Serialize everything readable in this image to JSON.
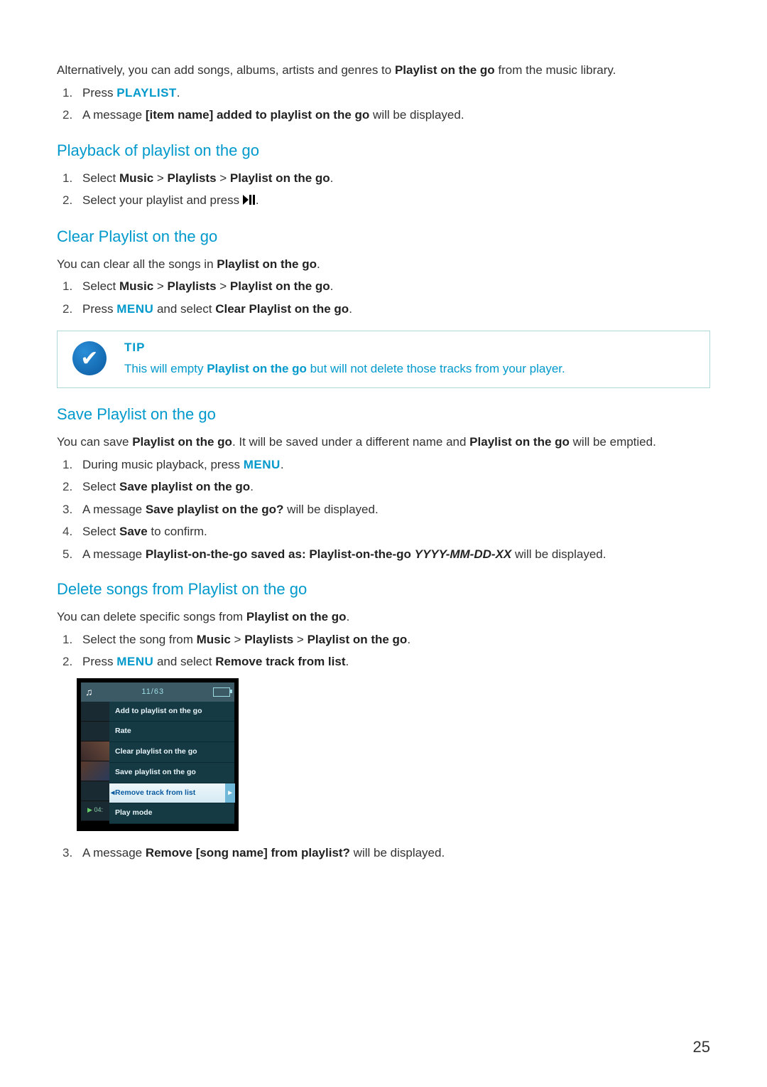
{
  "intro": {
    "text_pre": "Alternatively, you can add songs, albums, artists and genres to ",
    "bold": "Playlist on the go",
    "text_post": " from the music library."
  },
  "intro_steps": {
    "s1_pre": "Press ",
    "s1_key": "PLAYLIST",
    "s1_post": ".",
    "s2_pre": "A message ",
    "s2_bold": "[item name] added to playlist on the go",
    "s2_post": " will be displayed."
  },
  "playback": {
    "heading": "Playback of playlist on the go",
    "s1_pre": "Select ",
    "s1_b1": "Music",
    "s1_gt1": " > ",
    "s1_b2": "Playlists",
    "s1_gt2": " > ",
    "s1_b3": "Playlist on the go",
    "s1_post": ".",
    "s2_pre": "Select your playlist and press ",
    "s2_post": "."
  },
  "clear": {
    "heading": "Clear Playlist on the go",
    "intro_pre": "You can clear all the songs in ",
    "intro_bold": "Playlist on the go",
    "intro_post": ".",
    "s1_pre": "Select ",
    "s1_b1": "Music",
    "s1_gt1": " > ",
    "s1_b2": "Playlists",
    "s1_gt2": " > ",
    "s1_b3": "Playlist on the go",
    "s1_post": ".",
    "s2_pre": "Press ",
    "s2_key": "MENU",
    "s2_mid": " and select ",
    "s2_bold": "Clear Playlist on the go",
    "s2_post": "."
  },
  "tip": {
    "label": "TIP",
    "text_pre": "This will empty ",
    "text_bold": "Playlist on the go",
    "text_post": " but will not delete those tracks from your player."
  },
  "save": {
    "heading": "Save Playlist on the go",
    "intro_pre": "You can save ",
    "intro_b1": "Playlist on the go",
    "intro_mid": ". It will be saved under a different name and ",
    "intro_b2": "Playlist on the go",
    "intro_post": " will be emptied.",
    "s1_pre": "During music playback, press ",
    "s1_key": "MENU",
    "s1_post": ".",
    "s2_pre": "Select ",
    "s2_bold": "Save playlist on the go",
    "s2_post": ".",
    "s3_pre": "A message ",
    "s3_bold": "Save playlist on the go?",
    "s3_post": " will be displayed.",
    "s4_pre": "Select ",
    "s4_bold": "Save",
    "s4_post": " to confirm.",
    "s5_pre": "A message ",
    "s5_b1": "Playlist-on-the-go saved as: Playlist-on-the-go ",
    "s5_i": "YYYY-MM-DD-XX",
    "s5_post": " will be displayed."
  },
  "delete": {
    "heading": "Delete songs from Playlist on the go",
    "intro_pre": "You can delete specific songs from ",
    "intro_bold": "Playlist on the go",
    "intro_post": ".",
    "s1_pre": "Select the song from ",
    "s1_b1": "Music",
    "s1_gt1": " > ",
    "s1_b2": "Playlists",
    "s1_gt2": " > ",
    "s1_b3": "Playlist on the go",
    "s1_post": ".",
    "s2_pre": "Press ",
    "s2_key": "MENU",
    "s2_mid": " and select ",
    "s2_bold": "Remove track from list",
    "s2_post": ".",
    "s3_pre": "A message ",
    "s3_bold": "Remove [song name] from playlist?",
    "s3_post": " will be displayed."
  },
  "device": {
    "count": "11/63",
    "time": "04:",
    "menu": [
      "Add to playlist on the go",
      "Rate",
      "Clear playlist on the go",
      "Save playlist on the go",
      "Remove track from list",
      "Play mode"
    ],
    "selected_index": 4
  },
  "page_number": "25"
}
